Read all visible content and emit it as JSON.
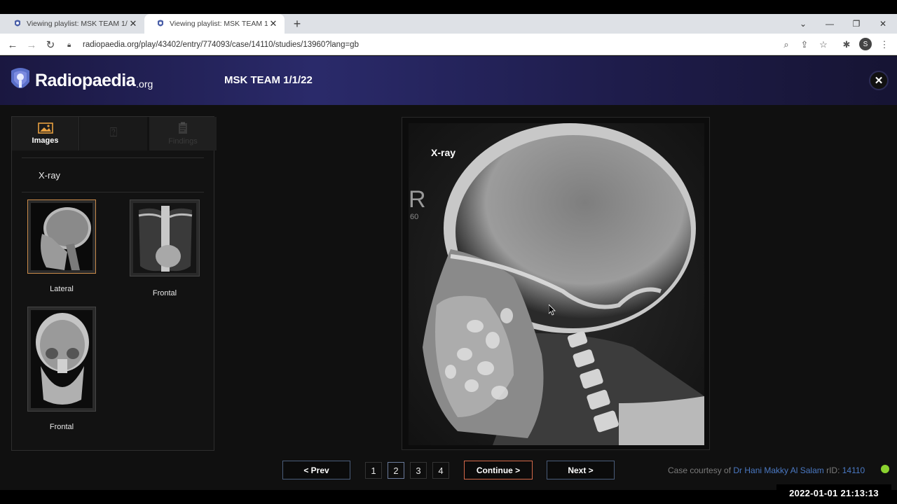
{
  "browser": {
    "tabs": [
      {
        "title": "Viewing playlist: MSK TEAM 1/1/",
        "active": false
      },
      {
        "title": "Viewing playlist: MSK TEAM 1/1/",
        "active": true
      }
    ],
    "url": "radiopaedia.org/play/43402/entry/774093/case/14110/studies/13960?lang=gb",
    "profile_initial": "S"
  },
  "header": {
    "brand": "Radiopaedia",
    "brand_tld": ".org",
    "title": "MSK TEAM 1/1/22"
  },
  "sidebar": {
    "tabs": [
      {
        "label": "Images",
        "icon": "image-icon"
      },
      {
        "label": "",
        "icon": "question-icon"
      },
      {
        "label": "Findings",
        "icon": "clipboard-icon"
      }
    ],
    "section_label": "X-ray",
    "thumbnails": [
      {
        "caption": "Lateral",
        "selected": true,
        "view": "lateral-skull"
      },
      {
        "caption": "Frontal",
        "selected": false,
        "view": "frontal-chest"
      },
      {
        "caption": "Frontal",
        "selected": false,
        "view": "frontal-skull"
      }
    ]
  },
  "viewer": {
    "modality_label": "X-ray",
    "marker_letter": "R",
    "marker_number": "60"
  },
  "controls": {
    "prev_label": "<   Prev",
    "pages": [
      "1",
      "2",
      "3",
      "4"
    ],
    "current_page": "2",
    "continue_label": "Continue    >",
    "next_label": "Next   >"
  },
  "footer": {
    "courtesy_prefix": "Case courtesy of ",
    "author": "Dr Hani Makky Al Salam",
    "rid_prefix": " rID: ",
    "rid": "14110",
    "status_color": "#8bd22f"
  },
  "overlay": {
    "timestamp": "2022-01-01  21:13:13"
  }
}
